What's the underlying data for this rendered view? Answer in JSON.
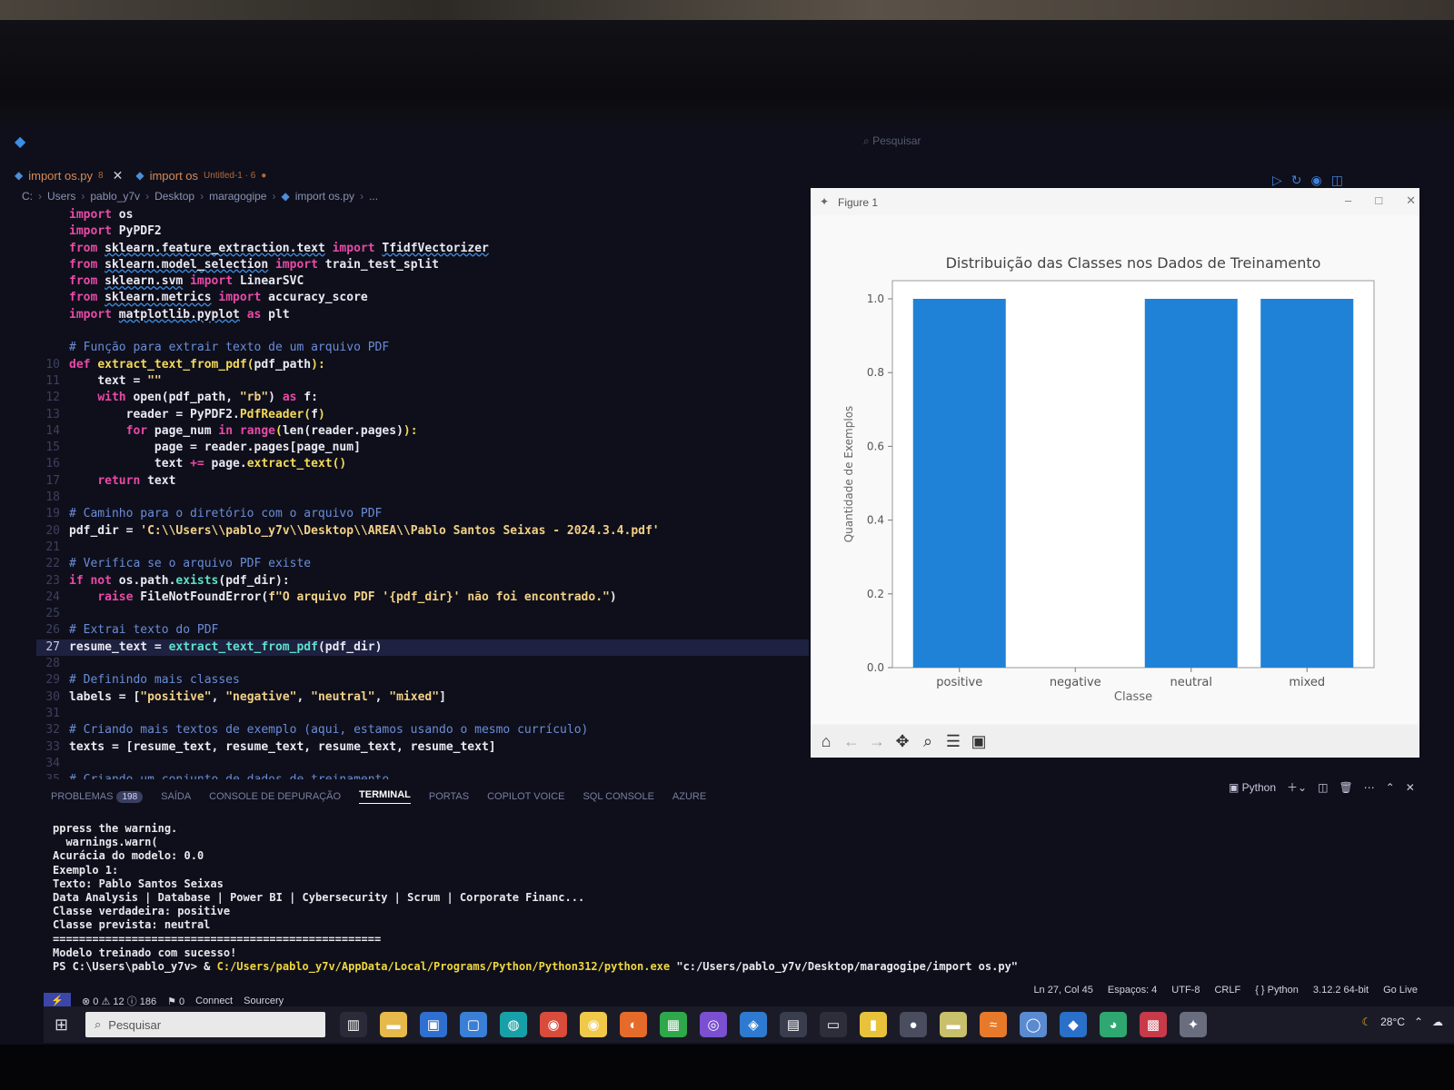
{
  "window": {
    "search_placeholder": "Pesquisar",
    "tabs": [
      {
        "label": "import os.py",
        "meta": "8",
        "closable": true
      },
      {
        "label": "import os",
        "meta": "Untitled-1 · 6",
        "closable": false
      }
    ],
    "breadcrumb": [
      "C:",
      "Users",
      "pablo_y7v",
      "Desktop",
      "maragogipe",
      "import os.py",
      "..."
    ]
  },
  "editor": {
    "active_line": 27,
    "lines": [
      {
        "n": "",
        "parts": [
          [
            "kw",
            "import"
          ],
          [
            "plain",
            " os"
          ]
        ]
      },
      {
        "n": "",
        "parts": [
          [
            "kw",
            "import"
          ],
          [
            "plain",
            " PyPDF2"
          ]
        ]
      },
      {
        "n": "",
        "parts": [
          [
            "kw",
            "from"
          ],
          [
            "plain",
            " "
          ],
          [
            "mod",
            "sklearn.feature_extraction.text"
          ],
          [
            "plain",
            " "
          ],
          [
            "kw",
            "import"
          ],
          [
            "plain",
            " "
          ],
          [
            "mod",
            "TfidfVectorizer"
          ]
        ]
      },
      {
        "n": "",
        "parts": [
          [
            "kw",
            "from"
          ],
          [
            "plain",
            " "
          ],
          [
            "mod",
            "sklearn.model_selection"
          ],
          [
            "plain",
            " "
          ],
          [
            "kw",
            "import"
          ],
          [
            "plain",
            " train_test_split"
          ]
        ]
      },
      {
        "n": "",
        "parts": [
          [
            "kw",
            "from"
          ],
          [
            "plain",
            " "
          ],
          [
            "mod",
            "sklearn.svm"
          ],
          [
            "plain",
            " "
          ],
          [
            "kw",
            "import"
          ],
          [
            "plain",
            " LinearSVC"
          ]
        ]
      },
      {
        "n": "",
        "parts": [
          [
            "kw",
            "from"
          ],
          [
            "plain",
            " "
          ],
          [
            "mod",
            "sklearn.metrics"
          ],
          [
            "plain",
            " "
          ],
          [
            "kw",
            "import"
          ],
          [
            "plain",
            " accuracy_score"
          ]
        ]
      },
      {
        "n": "",
        "parts": [
          [
            "kw",
            "import"
          ],
          [
            "plain",
            " "
          ],
          [
            "mod",
            "matplotlib.pyplot"
          ],
          [
            "plain",
            " "
          ],
          [
            "kw",
            "as"
          ],
          [
            "plain",
            " plt"
          ]
        ]
      },
      {
        "n": "",
        "parts": []
      },
      {
        "n": "",
        "parts": [
          [
            "cmt",
            "# Função para extrair texto de um arquivo PDF"
          ]
        ]
      },
      {
        "n": "10",
        "parts": [
          [
            "kw",
            "def"
          ],
          [
            "plain",
            " "
          ],
          [
            "fn",
            "extract_text_from_pdf"
          ],
          [
            "fn",
            "("
          ],
          [
            "plain",
            "pdf_path"
          ],
          [
            "fn",
            "):"
          ]
        ]
      },
      {
        "n": "11",
        "parts": [
          [
            "plain",
            "    text = "
          ],
          [
            "str",
            "\"\""
          ]
        ]
      },
      {
        "n": "12",
        "parts": [
          [
            "plain",
            "    "
          ],
          [
            "kw",
            "with"
          ],
          [
            "plain",
            " open(pdf_path, "
          ],
          [
            "str",
            "\"rb\""
          ],
          [
            "plain",
            ") "
          ],
          [
            "kw",
            "as"
          ],
          [
            "plain",
            " f:"
          ]
        ]
      },
      {
        "n": "13",
        "parts": [
          [
            "plain",
            "        reader = PyPDF2."
          ],
          [
            "fn",
            "PdfReader"
          ],
          [
            "fn",
            "("
          ],
          [
            "plain",
            "f"
          ],
          [
            "fn",
            ")"
          ]
        ]
      },
      {
        "n": "14",
        "parts": [
          [
            "plain",
            "        "
          ],
          [
            "kw",
            "for"
          ],
          [
            "plain",
            " page_num "
          ],
          [
            "kw",
            "in"
          ],
          [
            "plain",
            " "
          ],
          [
            "kw",
            "range"
          ],
          [
            "fn",
            "("
          ],
          [
            "plain",
            "len(reader.pages)"
          ],
          [
            "fn",
            "):"
          ]
        ]
      },
      {
        "n": "15",
        "parts": [
          [
            "plain",
            "            page = reader.pages[page_num]"
          ]
        ]
      },
      {
        "n": "16",
        "parts": [
          [
            "plain",
            "            text "
          ],
          [
            "kw",
            "+="
          ],
          [
            "plain",
            " page."
          ],
          [
            "fn",
            "extract_text"
          ],
          [
            "fn",
            "()"
          ]
        ]
      },
      {
        "n": "17",
        "parts": [
          [
            "plain",
            "    "
          ],
          [
            "kw",
            "return"
          ],
          [
            "plain",
            " text"
          ]
        ]
      },
      {
        "n": "18",
        "parts": []
      },
      {
        "n": "19",
        "parts": [
          [
            "cmt",
            "# Caminho para o diretório com o arquivo PDF"
          ]
        ]
      },
      {
        "n": "20",
        "parts": [
          [
            "plain",
            "pdf_dir = "
          ],
          [
            "str",
            "'C:\\\\Users\\\\pablo_y7v\\\\Desktop\\\\AREA\\\\Pablo Santos Seixas - 2024.3.4.pdf'"
          ]
        ]
      },
      {
        "n": "21",
        "parts": []
      },
      {
        "n": "22",
        "parts": [
          [
            "cmt",
            "# Verifica se o arquivo PDF existe"
          ]
        ]
      },
      {
        "n": "23",
        "parts": [
          [
            "kw",
            "if not"
          ],
          [
            "plain",
            " os.path."
          ],
          [
            "attr",
            "exists"
          ],
          [
            "plain",
            "(pdf_dir):"
          ]
        ]
      },
      {
        "n": "24",
        "parts": [
          [
            "plain",
            "    "
          ],
          [
            "kw",
            "raise"
          ],
          [
            "plain",
            " FileNotFoundError("
          ],
          [
            "str",
            "f\"O arquivo PDF '{pdf_dir}' não foi encontrado.\""
          ],
          [
            "plain",
            ")"
          ]
        ]
      },
      {
        "n": "25",
        "parts": []
      },
      {
        "n": "26",
        "parts": [
          [
            "cmt",
            "# Extrai texto do PDF"
          ]
        ]
      },
      {
        "n": "27",
        "parts": [
          [
            "plain",
            "resume_text = "
          ],
          [
            "attr",
            "extract_text_from_pdf"
          ],
          [
            "plain",
            "(pdf_dir)"
          ]
        ]
      },
      {
        "n": "28",
        "parts": []
      },
      {
        "n": "29",
        "parts": [
          [
            "cmt",
            "# Definindo mais classes"
          ]
        ]
      },
      {
        "n": "30",
        "parts": [
          [
            "plain",
            "labels = ["
          ],
          [
            "str",
            "\"positive\""
          ],
          [
            "plain",
            ", "
          ],
          [
            "str",
            "\"negative\""
          ],
          [
            "plain",
            ", "
          ],
          [
            "str",
            "\"neutral\""
          ],
          [
            "plain",
            ", "
          ],
          [
            "str",
            "\"mixed\""
          ],
          [
            "plain",
            "]"
          ]
        ]
      },
      {
        "n": "31",
        "parts": []
      },
      {
        "n": "32",
        "parts": [
          [
            "cmt",
            "# Criando mais textos de exemplo (aqui, estamos usando o mesmo currículo)"
          ]
        ]
      },
      {
        "n": "33",
        "parts": [
          [
            "plain",
            "texts = [resume_text, resume_text, resume_text, resume_text]"
          ]
        ]
      },
      {
        "n": "34",
        "parts": []
      },
      {
        "n": "35",
        "parts": [
          [
            "cmt",
            "# Criando um conjunto de dados de treinamento"
          ]
        ]
      }
    ]
  },
  "figure": {
    "window_title": "Figure 1",
    "toolbar_icons": [
      "home-icon",
      "back-arrow-icon",
      "forward-arrow-icon",
      "pan-icon",
      "zoom-icon",
      "configure-icon",
      "save-icon"
    ]
  },
  "chart_data": {
    "type": "bar",
    "title": "Distribuição das Classes nos Dados de Treinamento",
    "xlabel": "Classe",
    "ylabel": "Quantidade de Exemplos",
    "categories": [
      "positive",
      "negative",
      "neutral",
      "mixed"
    ],
    "values": [
      1.0,
      0.0,
      1.0,
      1.0
    ],
    "ylim": [
      0,
      1.0
    ],
    "yticks": [
      "0.0",
      "0.2",
      "0.4",
      "0.6",
      "0.8",
      "1.0"
    ],
    "bar_color": "#1f82d6",
    "grid": false
  },
  "panel": {
    "tabs": [
      {
        "label": "PROBLEMAS",
        "badge": "198"
      },
      {
        "label": "SAÍDA"
      },
      {
        "label": "CONSOLE DE DEPURAÇÃO"
      },
      {
        "label": "TERMINAL",
        "active": true
      },
      {
        "label": "PORTAS"
      },
      {
        "label": "COPILOT VOICE"
      },
      {
        "label": "SQL CONSOLE"
      },
      {
        "label": "AZURE"
      }
    ],
    "shell_label": "Python"
  },
  "terminal": {
    "lines": [
      "ppress the warning.",
      "  warnings.warn(",
      "Acurácia do modelo: 0.0",
      "Exemplo 1:",
      "Texto: Pablo Santos Seixas",
      "Data Analysis | Database | Power BI | Cybersecurity | Scrum | Corporate Financ...",
      "Classe verdadeira: positive",
      "Classe prevista: neutral",
      "==================================================",
      "Modelo treinado com sucesso!"
    ],
    "prompt": "PS C:\\Users\\pablo_y7v> & ",
    "command_path": "C:/Users/pablo_y7v/AppData/Local/Programs/Python/Python312/python.exe",
    "command_arg": " \"c:/Users/pablo_y7v/Desktop/maragogipe/import os.py\""
  },
  "statusbar": {
    "left": [
      "⊗ 0 ⚠ 12 ⓘ 186",
      "⚑ 0",
      "Connect",
      "Sourcery"
    ],
    "right": [
      "Ln 27, Col 45",
      "Espaços: 4",
      "UTF-8",
      "CRLF",
      "{ } Python",
      "3.12.2 64-bit",
      "Go Live"
    ]
  },
  "taskbar": {
    "search_placeholder": "Pesquisar",
    "temperature": "28°C"
  }
}
